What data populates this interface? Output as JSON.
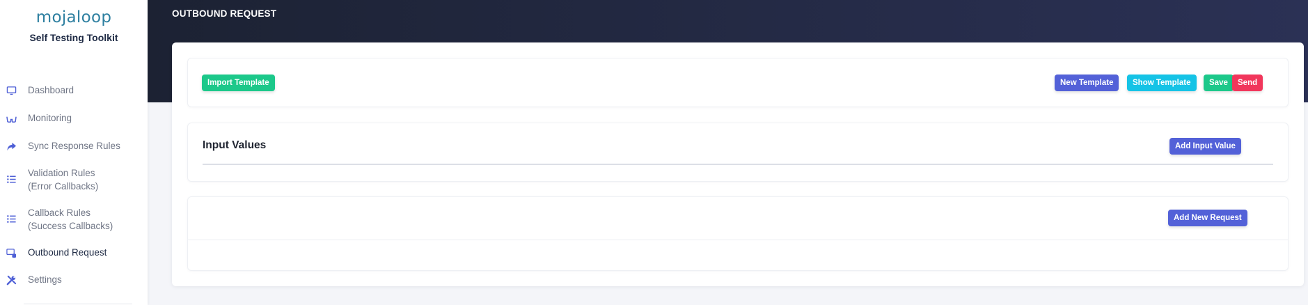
{
  "brand": {
    "logo": "mojaloop",
    "subtitle": "Self Testing Toolkit",
    "accent": "#2d7fa0"
  },
  "sidebar": {
    "items": [
      {
        "name": "dashboard",
        "icon": "monitor-icon",
        "lines": [
          "Dashboard"
        ],
        "active": false
      },
      {
        "name": "monitoring",
        "icon": "glasses-icon",
        "lines": [
          "Monitoring"
        ],
        "active": false
      },
      {
        "name": "sync-response-rules",
        "icon": "share-arrow-icon",
        "lines": [
          "Sync Response Rules"
        ],
        "active": false
      },
      {
        "name": "validation-rules",
        "icon": "list-icon",
        "lines": [
          "Validation Rules",
          "(Error Callbacks)"
        ],
        "active": false
      },
      {
        "name": "callback-rules",
        "icon": "list-icon",
        "lines": [
          "Callback Rules",
          "(Success Callbacks)"
        ],
        "active": false
      },
      {
        "name": "outbound-request",
        "icon": "database-icon",
        "lines": [
          "Outbound Request"
        ],
        "active": true
      },
      {
        "name": "settings",
        "icon": "tools-icon",
        "lines": [
          "Settings"
        ],
        "active": false
      }
    ]
  },
  "header": {
    "title": "OUTBOUND REQUEST",
    "gradient": [
      "#1c2233",
      "#2b3155"
    ]
  },
  "toolbar": {
    "import_label": "Import Template",
    "new_template_label": "New Template",
    "show_template_label": "Show Template",
    "save_label": "Save",
    "send_label": "Send"
  },
  "input_values": {
    "title": "Input Values",
    "add_label": "Add Input Value"
  },
  "requests": {
    "add_label": "Add New Request"
  },
  "colors": {
    "green": "#1cc88a",
    "indigo": "#5361d8",
    "cyan": "#15c3e6",
    "red": "#f1365b",
    "nav_icon": "#4e5fd6"
  }
}
